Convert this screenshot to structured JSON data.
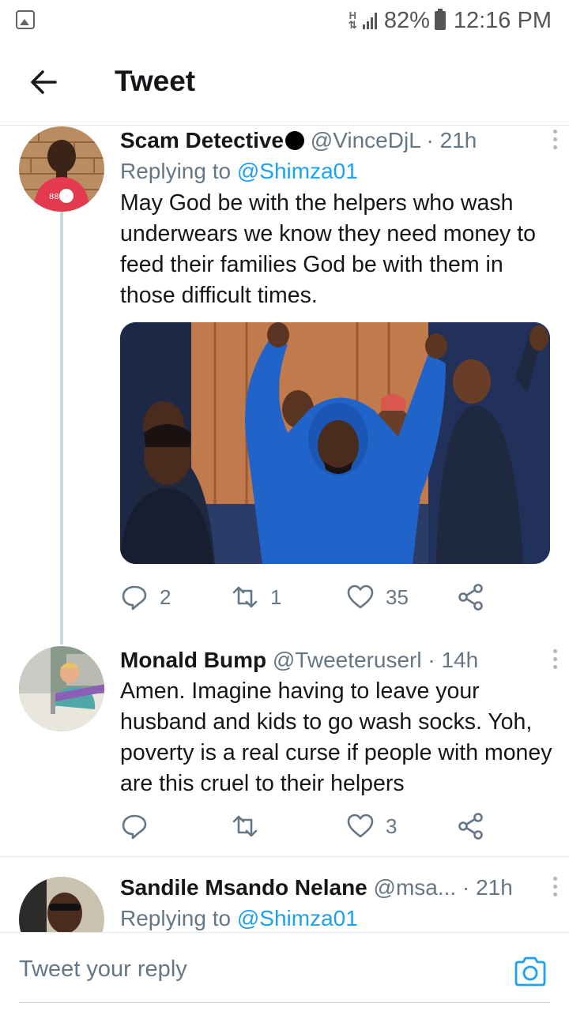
{
  "status_bar": {
    "network": "H",
    "battery": "82%",
    "time": "12:16 PM"
  },
  "header": {
    "title": "Tweet"
  },
  "tweets": [
    {
      "name": "Scam Detective",
      "handle": "@VinceDjL",
      "time": "· 21h",
      "replying_prefix": "Replying to",
      "replying_to": "@Shimza01",
      "text": "May God be with the helpers  who wash underwears we know they need money to feed their families God be with them in those difficult times.",
      "replies": "2",
      "retweets": "1",
      "likes": "35"
    },
    {
      "name": "Monald Bump",
      "handle": "@Tweeteruserl",
      "time": "· 14h",
      "text": "Amen. Imagine having to leave your husband and kids to go wash socks. Yoh, poverty is a real curse if people with money are this cruel to their helpers",
      "replies": "",
      "retweets": "",
      "likes": "3"
    },
    {
      "name": "Sandile Msando Nelane",
      "handle": "@msa...",
      "time": "· 21h",
      "replying_prefix": "Replying to",
      "replying_to": "@Shimza01"
    }
  ],
  "reply_bar": {
    "placeholder": "Tweet your reply"
  },
  "colors": {
    "accent": "#1da1f2",
    "muted": "#657786",
    "text": "#14171a"
  }
}
